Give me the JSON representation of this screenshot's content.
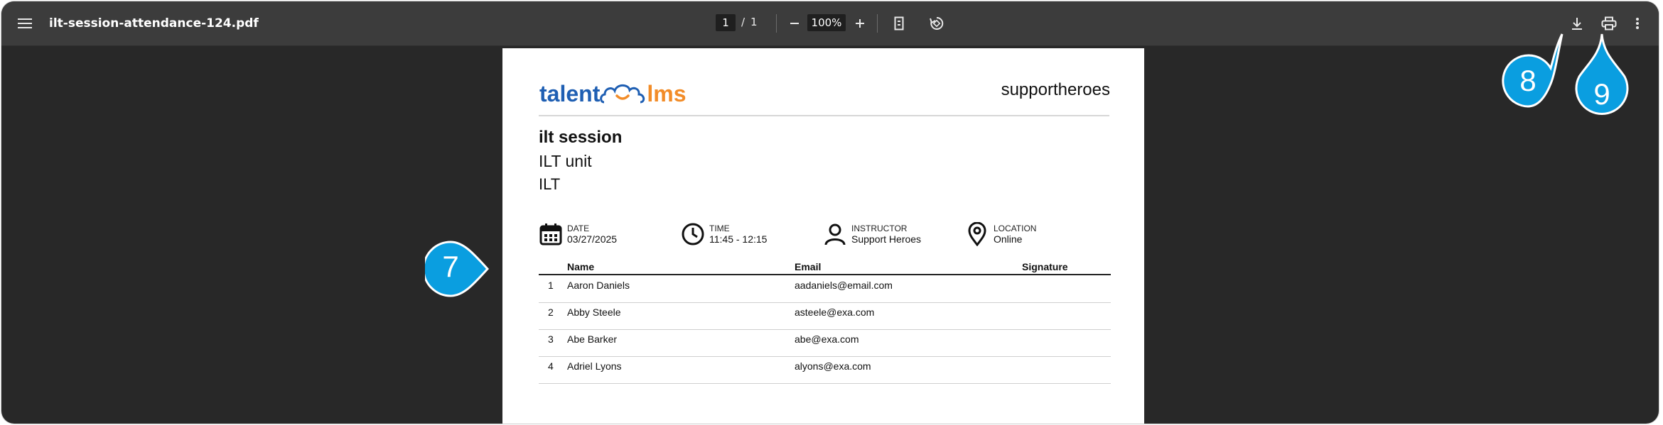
{
  "viewer": {
    "filename": "ilt-session-attendance-124.pdf",
    "current_page": "1",
    "page_separator": "/",
    "total_pages": "1",
    "zoom": "100%"
  },
  "document": {
    "logo_part1": "talent",
    "logo_part2": "lms",
    "organization": "supportheroes",
    "session_title": "ilt session",
    "unit_name": "ILT unit",
    "session_type": "ILT",
    "info": {
      "date_label": "DATE",
      "date_value": "03/27/2025",
      "time_label": "TIME",
      "time_value": "11:45 - 12:15",
      "instructor_label": "INSTRUCTOR",
      "instructor_value": "Support Heroes",
      "location_label": "LOCATION",
      "location_value": "Online"
    },
    "table": {
      "headers": {
        "name": "Name",
        "email": "Email",
        "signature": "Signature"
      },
      "rows": [
        {
          "num": "1",
          "name": "Aaron Daniels",
          "email": "aadaniels@email.com"
        },
        {
          "num": "2",
          "name": "Abby Steele",
          "email": "asteele@exa.com"
        },
        {
          "num": "3",
          "name": "Abe Barker",
          "email": "abe@exa.com"
        },
        {
          "num": "4",
          "name": "Adriel Lyons",
          "email": "alyons@exa.com"
        }
      ]
    }
  },
  "callouts": {
    "c7": "7",
    "c8": "8",
    "c9": "9"
  },
  "colors": {
    "callout": "#0a9ee0",
    "toolbar": "#3c3c3c",
    "background": "#282828"
  }
}
